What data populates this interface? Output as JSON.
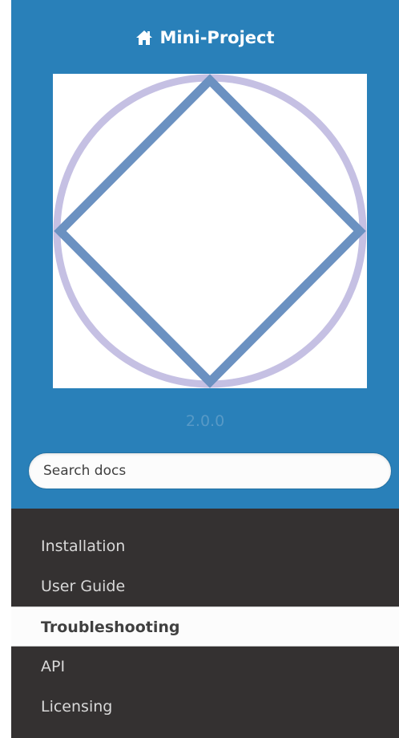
{
  "header": {
    "project_name": "Mini-Project",
    "home_icon": "home-icon"
  },
  "logo": {
    "circle_color": "#c5c0e3",
    "diamond_color": "#6b91c1"
  },
  "version": "2.0.0",
  "search": {
    "placeholder": "Search docs",
    "value": ""
  },
  "nav": {
    "items": [
      {
        "label": "Installation",
        "current": false
      },
      {
        "label": "User Guide",
        "current": false
      },
      {
        "label": "Troubleshooting",
        "current": true
      },
      {
        "label": "API",
        "current": false
      },
      {
        "label": "Licensing",
        "current": false
      }
    ]
  },
  "colors": {
    "brand_blue": "#2980b9",
    "sidebar_dark": "#343131",
    "version_text": "#5799c6"
  }
}
